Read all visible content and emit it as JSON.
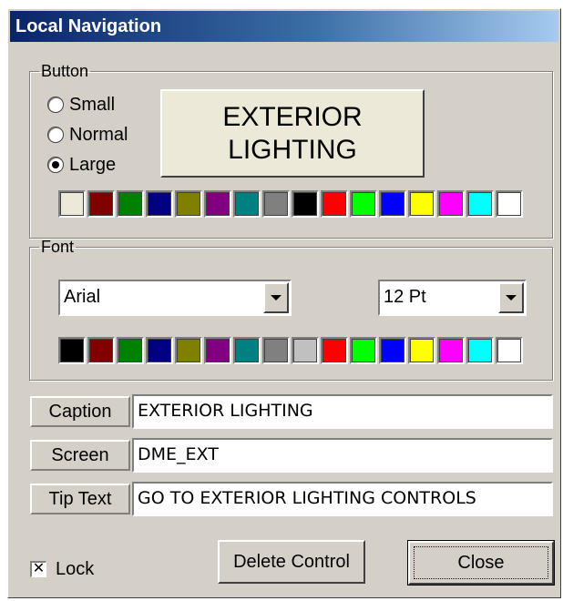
{
  "window": {
    "title": "Local Navigation"
  },
  "button_group": {
    "legend": "Button",
    "sizes": [
      {
        "label": "Small",
        "checked": false
      },
      {
        "label": "Normal",
        "checked": false
      },
      {
        "label": "Large",
        "checked": true
      }
    ],
    "preview_line1": "EXTERIOR",
    "preview_line2": "LIGHTING",
    "preview_color": "#ece9d8",
    "palette": [
      "#ece9d8",
      "#800000",
      "#008000",
      "#000080",
      "#808000",
      "#800080",
      "#008080",
      "#808080",
      "#000000",
      "#ff0000",
      "#00ff00",
      "#0000ff",
      "#ffff00",
      "#ff00ff",
      "#00ffff",
      "#ffffff"
    ]
  },
  "font_group": {
    "legend": "Font",
    "font_name": "Arial",
    "font_size": "12 Pt",
    "palette": [
      "#000000",
      "#800000",
      "#008000",
      "#000080",
      "#808000",
      "#800080",
      "#008080",
      "#808080",
      "#c0c0c0",
      "#ff0000",
      "#00ff00",
      "#0000ff",
      "#ffff00",
      "#ff00ff",
      "#00ffff",
      "#ffffff"
    ]
  },
  "fields": {
    "caption_label": "Caption",
    "caption_value": "EXTERIOR LIGHTING",
    "screen_label": "Screen",
    "screen_value": "DME_EXT",
    "tip_label": "Tip Text",
    "tip_value": "GO TO EXTERIOR LIGHTING CONTROLS"
  },
  "footer": {
    "lock_label": "Lock",
    "lock_checked": true,
    "delete_label": "Delete Control",
    "close_label": "Close"
  }
}
